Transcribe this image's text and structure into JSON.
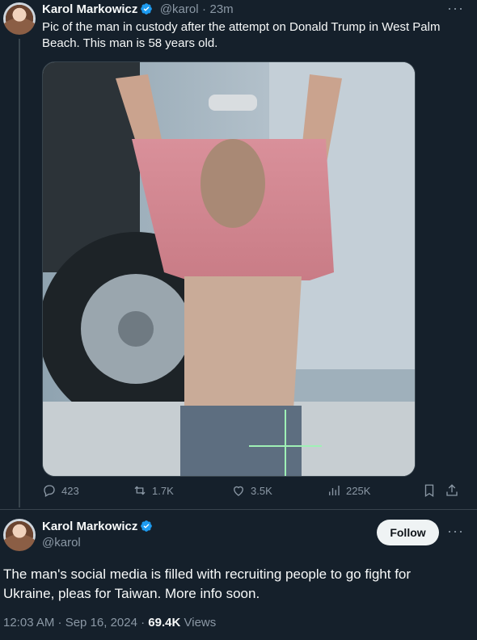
{
  "quoted_tweet": {
    "author_name": "Karol Markowicz",
    "handle": "@karol",
    "time": "23m",
    "separator": "·",
    "text": "Pic of the man in custody after the attempt on Donald Trump in West Palm Beach. This man is 58 years old.",
    "actions": {
      "replies": "423",
      "reposts": "1.7K",
      "likes": "3.5K",
      "views": "225K"
    }
  },
  "main_tweet": {
    "author_name": "Karol Markowicz",
    "handle": "@karol",
    "follow_label": "Follow",
    "text": "The man's social media is filled with recruiting people to go fight for Ukraine, pleas for Taiwan. More info soon.",
    "timestamp": "12:03 AM · Sep 16, 2024",
    "dot": "·",
    "views_count": "69.4K",
    "views_label": "Views"
  },
  "icons": {
    "more": "more-horizontal-icon",
    "verified": "verified-badge-icon",
    "reply": "reply-icon",
    "repost": "repost-icon",
    "like": "heart-icon",
    "views": "views-chart-icon",
    "bookmark": "bookmark-icon",
    "share": "share-icon"
  },
  "colors": {
    "background": "#15202b",
    "text": "#f7f9f9",
    "muted": "#8b98a5",
    "verified": "#1d9bf0",
    "divider": "#38444d"
  }
}
